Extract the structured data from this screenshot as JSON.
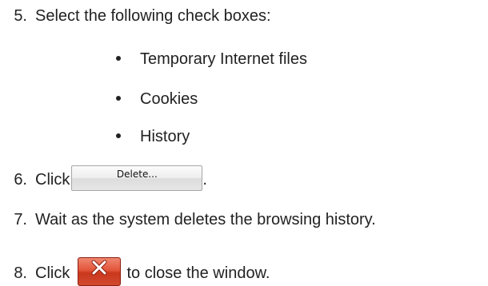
{
  "steps": [
    {
      "number": "5.",
      "text": "Select the following check boxes:"
    },
    {
      "number": "6.",
      "text_before": "Click",
      "text_after": "."
    },
    {
      "number": "7.",
      "text": "Wait as the system deletes the browsing history."
    },
    {
      "number": "8.",
      "text_before": "Click",
      "text_after": "to close the window."
    }
  ],
  "checkboxes": [
    "Temporary Internet files",
    "Cookies",
    "History"
  ],
  "delete_button_label": "Delete...",
  "close_button_icon": "close-x-icon",
  "colors": {
    "text": "#222222",
    "close_button": "#d9472b"
  }
}
